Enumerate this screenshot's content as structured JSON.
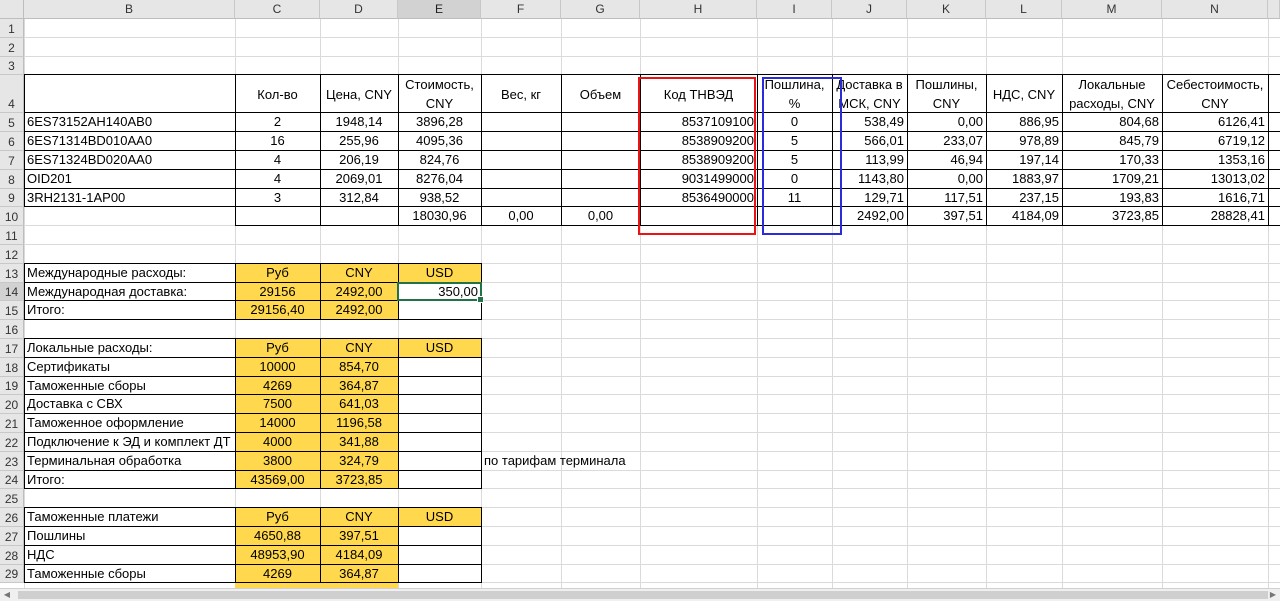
{
  "columns": [
    "B",
    "C",
    "D",
    "E",
    "F",
    "G",
    "H",
    "I",
    "J",
    "K",
    "L",
    "M",
    "N"
  ],
  "rows": [
    "1",
    "2",
    "3",
    "4",
    "5",
    "6",
    "7",
    "8",
    "9",
    "10",
    "11",
    "12",
    "13",
    "14",
    "15",
    "16",
    "17",
    "18",
    "19",
    "20",
    "21",
    "22",
    "23",
    "24",
    "25",
    "26",
    "27",
    "28",
    "29"
  ],
  "table": {
    "headers": [
      "Кол-во",
      "Цена, CNY",
      "Стоимость, CNY",
      "Вес, кг",
      "Объем",
      "Код ТНВЭД",
      "Пошлина, %",
      "Доставка в МСК, CNY",
      "Пошлины, CNY",
      "НДС, CNY",
      "Локальные расходы, CNY",
      "Себестоимость, CNY"
    ],
    "items": [
      {
        "name": "6ES73152AH140AB0",
        "qty": "2",
        "price": "1948,14",
        "cost": "3896,28",
        "weight": "",
        "volume": "",
        "code": "8537109100",
        "duty": "0",
        "delivery": "538,49",
        "duties": "0,00",
        "vat": "886,95",
        "local": "804,68",
        "selfcost": "6126,41"
      },
      {
        "name": "6ES71314BD010AA0",
        "qty": "16",
        "price": "255,96",
        "cost": "4095,36",
        "weight": "",
        "volume": "",
        "code": "8538909200",
        "duty": "5",
        "delivery": "566,01",
        "duties": "233,07",
        "vat": "978,89",
        "local": "845,79",
        "selfcost": "6719,12"
      },
      {
        "name": "6ES71324BD020AA0",
        "qty": "4",
        "price": "206,19",
        "cost": "824,76",
        "weight": "",
        "volume": "",
        "code": "8538909200",
        "duty": "5",
        "delivery": "113,99",
        "duties": "46,94",
        "vat": "197,14",
        "local": "170,33",
        "selfcost": "1353,16"
      },
      {
        "name": "OID201",
        "qty": "4",
        "price": "2069,01",
        "cost": "8276,04",
        "weight": "",
        "volume": "",
        "code": "9031499000",
        "duty": "0",
        "delivery": "1143,80",
        "duties": "0,00",
        "vat": "1883,97",
        "local": "1709,21",
        "selfcost": "13013,02"
      },
      {
        "name": "3RH2131-1AP00",
        "qty": "3",
        "price": "312,84",
        "cost": "938,52",
        "weight": "",
        "volume": "",
        "code": "8536490000",
        "duty": "11",
        "delivery": "129,71",
        "duties": "117,51",
        "vat": "237,15",
        "local": "193,83",
        "selfcost": "1616,71"
      }
    ],
    "totals": {
      "cost": "18030,96",
      "weight": "0,00",
      "volume": "0,00",
      "delivery": "2492,00",
      "duties": "397,51",
      "vat": "4184,09",
      "local": "3723,85",
      "selfcost": "28828,41"
    }
  },
  "intl": {
    "title": "Международные расходы:",
    "h_rub": "Руб",
    "h_cny": "CNY",
    "h_usd": "USD",
    "rows": [
      {
        "label": "Международная доставка:",
        "rub": "29156",
        "cny": "2492,00",
        "usd": "350,00"
      },
      {
        "label": "Итого:",
        "rub": "29156,40",
        "cny": "2492,00",
        "usd": ""
      }
    ]
  },
  "local": {
    "title": "Локальные расходы:",
    "h_rub": "Руб",
    "h_cny": "CNY",
    "h_usd": "USD",
    "rows": [
      {
        "label": "Сертификаты",
        "rub": "10000",
        "cny": "854,70",
        "usd": ""
      },
      {
        "label": "Таможенные сборы",
        "rub": "4269",
        "cny": "364,87",
        "usd": ""
      },
      {
        "label": "Доставка с СВХ",
        "rub": "7500",
        "cny": "641,03",
        "usd": ""
      },
      {
        "label": "Таможенное оформление",
        "rub": "14000",
        "cny": "1196,58",
        "usd": ""
      },
      {
        "label": "Подключение к ЭД и  комплект ДТ",
        "rub": "4000",
        "cny": "341,88",
        "usd": ""
      },
      {
        "label": "Терминальная обработка",
        "rub": "3800",
        "cny": "324,79",
        "usd": ""
      },
      {
        "label": "Итого:",
        "rub": "43569,00",
        "cny": "3723,85",
        "usd": ""
      }
    ],
    "note": "по тарифам терминала"
  },
  "customs": {
    "title": "Таможенные платежи",
    "h_rub": "Руб",
    "h_cny": "CNY",
    "h_usd": "USD",
    "rows": [
      {
        "label": "Пошлины",
        "rub": "4650,88",
        "cny": "397,51",
        "usd": ""
      },
      {
        "label": "НДС",
        "rub": "48953,90",
        "cny": "4184,09",
        "usd": ""
      },
      {
        "label": "Таможенные сборы",
        "rub": "4269",
        "cny": "364,87",
        "usd": ""
      }
    ]
  },
  "colors": {
    "yellow": "#ffd84d",
    "red_box": "#e11111",
    "blue_box": "#2b2bd9",
    "selection": "#217346"
  }
}
